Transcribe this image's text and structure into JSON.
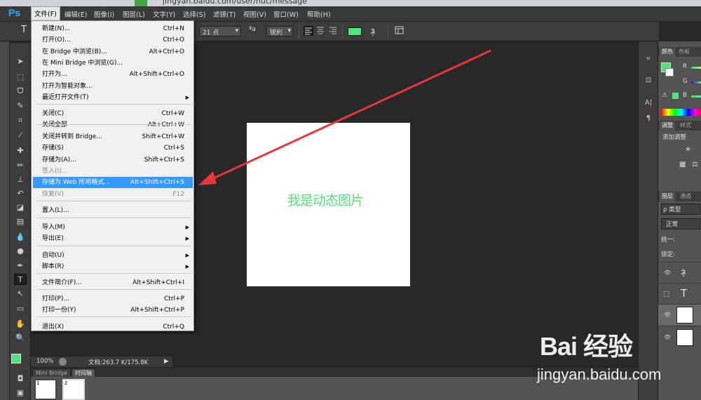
{
  "browser": {
    "url": "jingyan.baidu.com/user/nuc/message"
  },
  "app": {
    "logo": "Ps"
  },
  "menubar": [
    {
      "label": "文件(F)"
    },
    {
      "label": "编辑(E)"
    },
    {
      "label": "图像(I)"
    },
    {
      "label": "图层(L)"
    },
    {
      "label": "文字(Y)"
    },
    {
      "label": "选择(S)"
    },
    {
      "label": "滤镜(T)"
    },
    {
      "label": "视图(V)"
    },
    {
      "label": "窗口(W)"
    },
    {
      "label": "帮助(H)"
    }
  ],
  "options": {
    "font_size": "21 点",
    "aa_label": "ªa",
    "aa_mode": "锐利",
    "text_color": "#54e27a"
  },
  "file_menu": {
    "items": [
      {
        "label": "新建(N)...",
        "shortcut": "Ctrl+N"
      },
      {
        "label": "打开(O)...",
        "shortcut": "Ctrl+O"
      },
      {
        "label": "在 Bridge 中浏览(B)...",
        "shortcut": "Alt+Ctrl+O"
      },
      {
        "label": "在 Mini Bridge 中浏览(G)...",
        "shortcut": ""
      },
      {
        "label": "打开为...",
        "shortcut": "Alt+Shift+Ctrl+O"
      },
      {
        "label": "打开为智能对象...",
        "shortcut": ""
      },
      {
        "label": "最近打开文件(T)",
        "shortcut": "",
        "submenu": true
      },
      {
        "label": "关闭(C)",
        "shortcut": "Ctrl+W"
      },
      {
        "label": "关闭全部",
        "shortcut": "Alt+Ctrl+W"
      },
      {
        "label": "关闭并转到 Bridge...",
        "shortcut": "Shift+Ctrl+W"
      },
      {
        "label": "存储(S)",
        "shortcut": "Ctrl+S"
      },
      {
        "label": "存储为(A)...",
        "shortcut": "Shift+Ctrl+S"
      },
      {
        "label": "签入(I)...",
        "shortcut": "",
        "disabled": true
      },
      {
        "label": "存储为 Web 所用格式...",
        "shortcut": "Alt+Shift+Ctrl+S",
        "highlight": true
      },
      {
        "label": "恢复(V)",
        "shortcut": "F12",
        "disabled": true
      },
      {
        "label": "置入(L)...",
        "shortcut": ""
      },
      {
        "label": "导入(M)",
        "shortcut": "",
        "submenu": true
      },
      {
        "label": "导出(E)",
        "shortcut": "",
        "submenu": true
      },
      {
        "label": "自动(U)",
        "shortcut": "",
        "submenu": true
      },
      {
        "label": "脚本(R)",
        "shortcut": "",
        "submenu": true
      },
      {
        "label": "文件简介(F)...",
        "shortcut": "Alt+Shift+Ctrl+I"
      },
      {
        "label": "打印(P)...",
        "shortcut": "Ctrl+P"
      },
      {
        "label": "打印一份(Y)",
        "shortcut": "Alt+Shift+Ctrl+P"
      },
      {
        "label": "退出(X)",
        "shortcut": "Ctrl+Q"
      }
    ]
  },
  "document": {
    "text": "我是动态图片",
    "text_color": "#54e27a"
  },
  "status": {
    "zoom": "100%",
    "doc_size": "文档:263.7 K/175.8K"
  },
  "bottom_panel": {
    "tabs": [
      "Mini Bridge",
      "时间轴"
    ],
    "frames": [
      "1",
      "2"
    ]
  },
  "right_panel": {
    "color_tabs": [
      "颜色",
      "色板"
    ],
    "channels": [
      "R",
      "G",
      "B"
    ],
    "adjust_tabs": [
      "调整",
      "样式"
    ],
    "adjust_title": "添加调整",
    "layer_tabs": [
      "图层",
      "通道"
    ],
    "filter_label": "ρ 类型",
    "blend_mode": "正常",
    "unify_label": "统一:",
    "lock_label": "锁定:"
  },
  "watermark": {
    "logo": "Bai 经验",
    "url": "jingyan.baidu.com"
  },
  "colors": {
    "highlight": "#3399ff",
    "arrow": "#e8363a",
    "ps_blue": "#31a8ff"
  }
}
